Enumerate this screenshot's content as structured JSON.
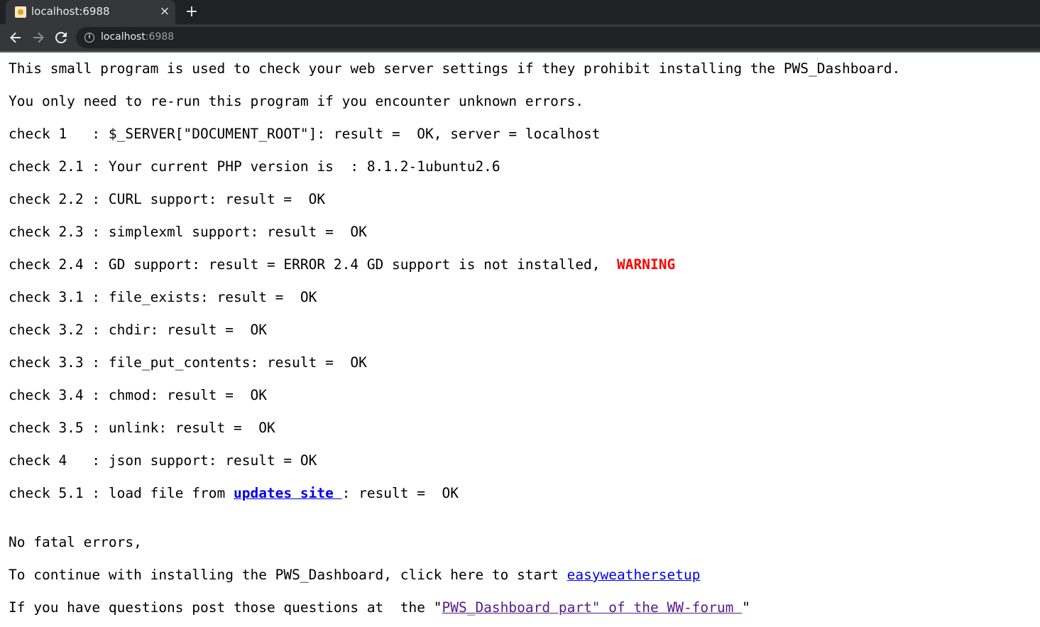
{
  "browser": {
    "tab_title": "localhost:6988",
    "tab_close": "×",
    "new_tab": "+",
    "url_host": "localhost",
    "url_port": ":6988",
    "info_glyph": "i"
  },
  "colors": {
    "warning": "#ff0000",
    "link": "#0000ee",
    "visited_link": "#551a8b"
  },
  "page": {
    "intro": "This small program is used to check your web server settings if they prohibit installing the PWS_Dashboard.",
    "rerun_note": "You only need to re-run this program if you encounter unknown errors.",
    "checks": [
      "check 1   : $_SERVER[\"DOCUMENT_ROOT\"]: result =  OK, server = localhost",
      "check 2.1 : Your current PHP version is  : 8.1.2-1ubuntu2.6",
      "check 2.2 : CURL support: result =  OK",
      "check 2.3 : simplexml support: result =  OK",
      "check 2.4 : GD support: result = ERROR 2.4 GD support is not installed,  ",
      "check 3.1 : file_exists: result =  OK",
      "check 3.2 : chdir: result =  OK",
      "check 3.3 : file_put_contents: result =  OK",
      "check 3.4 : chmod: result =  OK",
      "check 3.5 : unlink: result =  OK",
      "check 4   : json support: result = OK"
    ],
    "check_24_warning": "WARNING",
    "check_51_prefix": "check 5.1 : load file from ",
    "check_51_link": "updates site ",
    "check_51_suffix": ": result =  OK",
    "no_fatal": "No fatal errors,",
    "continue_prefix": "To continue with installing the PWS_Dashboard, click here to start ",
    "continue_link": "easyweathersetup",
    "questions_prefix": "If you have questions post those questions at  the \"",
    "questions_link": "PWS_Dashboard part\" of the WW-forum ",
    "questions_suffix": "\""
  }
}
